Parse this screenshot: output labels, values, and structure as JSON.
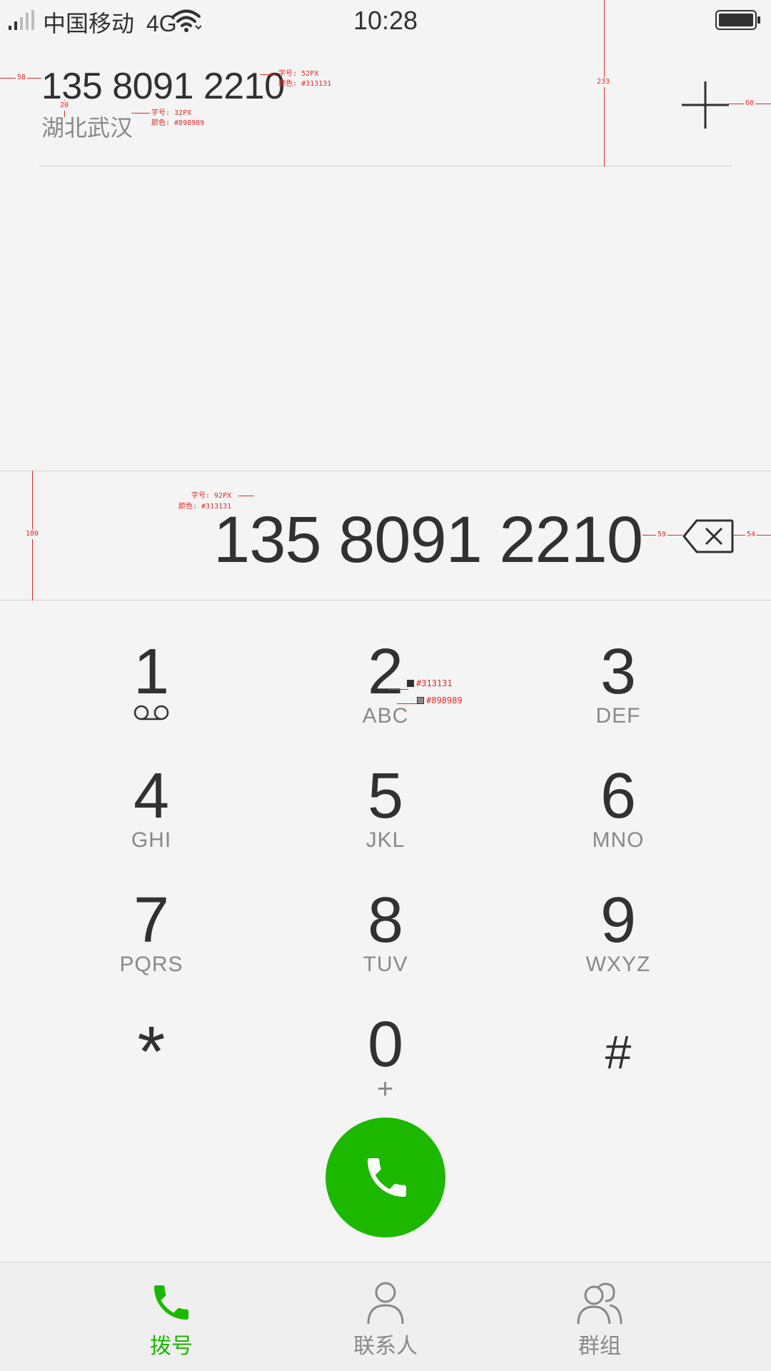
{
  "status_bar": {
    "carrier": "中国移动",
    "network": "4G",
    "time": "10:28"
  },
  "match": {
    "number": "135 8091 2210",
    "location": "湖北武汉",
    "add_icon": "plus-icon"
  },
  "dialer": {
    "number": "135 8091 2210",
    "backspace_icon": "backspace-icon"
  },
  "keypad": {
    "keys": [
      {
        "digit": "1",
        "letters": "",
        "icon": "voicemail-icon"
      },
      {
        "digit": "2",
        "letters": "ABC"
      },
      {
        "digit": "3",
        "letters": "DEF"
      },
      {
        "digit": "4",
        "letters": "GHI"
      },
      {
        "digit": "5",
        "letters": "JKL"
      },
      {
        "digit": "6",
        "letters": "MNO"
      },
      {
        "digit": "7",
        "letters": "PQRS"
      },
      {
        "digit": "8",
        "letters": "TUV"
      },
      {
        "digit": "9",
        "letters": "WXYZ"
      },
      {
        "digit": "*",
        "letters": ""
      },
      {
        "digit": "0",
        "letters": "+"
      },
      {
        "digit": "#",
        "letters": ""
      }
    ]
  },
  "call_button": {
    "icon": "phone-icon",
    "color": "#1cb800"
  },
  "tabs": [
    {
      "label": "拨号",
      "icon": "phone-icon",
      "active": true,
      "color": "#1cb800"
    },
    {
      "label": "联系人",
      "icon": "person-icon",
      "active": false,
      "color": "#898989"
    },
    {
      "label": "群组",
      "icon": "group-icon",
      "active": false,
      "color": "#898989"
    }
  ],
  "annotations": {
    "match_number_size": "字号: 52PX",
    "match_number_color": "颜色: #313131",
    "location_size": "字号: 32PX",
    "location_color": "颜色: #898989",
    "dialed_size": "字号: 92PX",
    "dialed_color": "颜色: #313131",
    "digit_color": "#313131",
    "letters_color": "#898989",
    "left_margin": "58",
    "gap_20": "20",
    "height_233": "233",
    "right_margin_60": "60",
    "height_180": "180",
    "gap_59": "59",
    "right_margin_54": "54"
  }
}
